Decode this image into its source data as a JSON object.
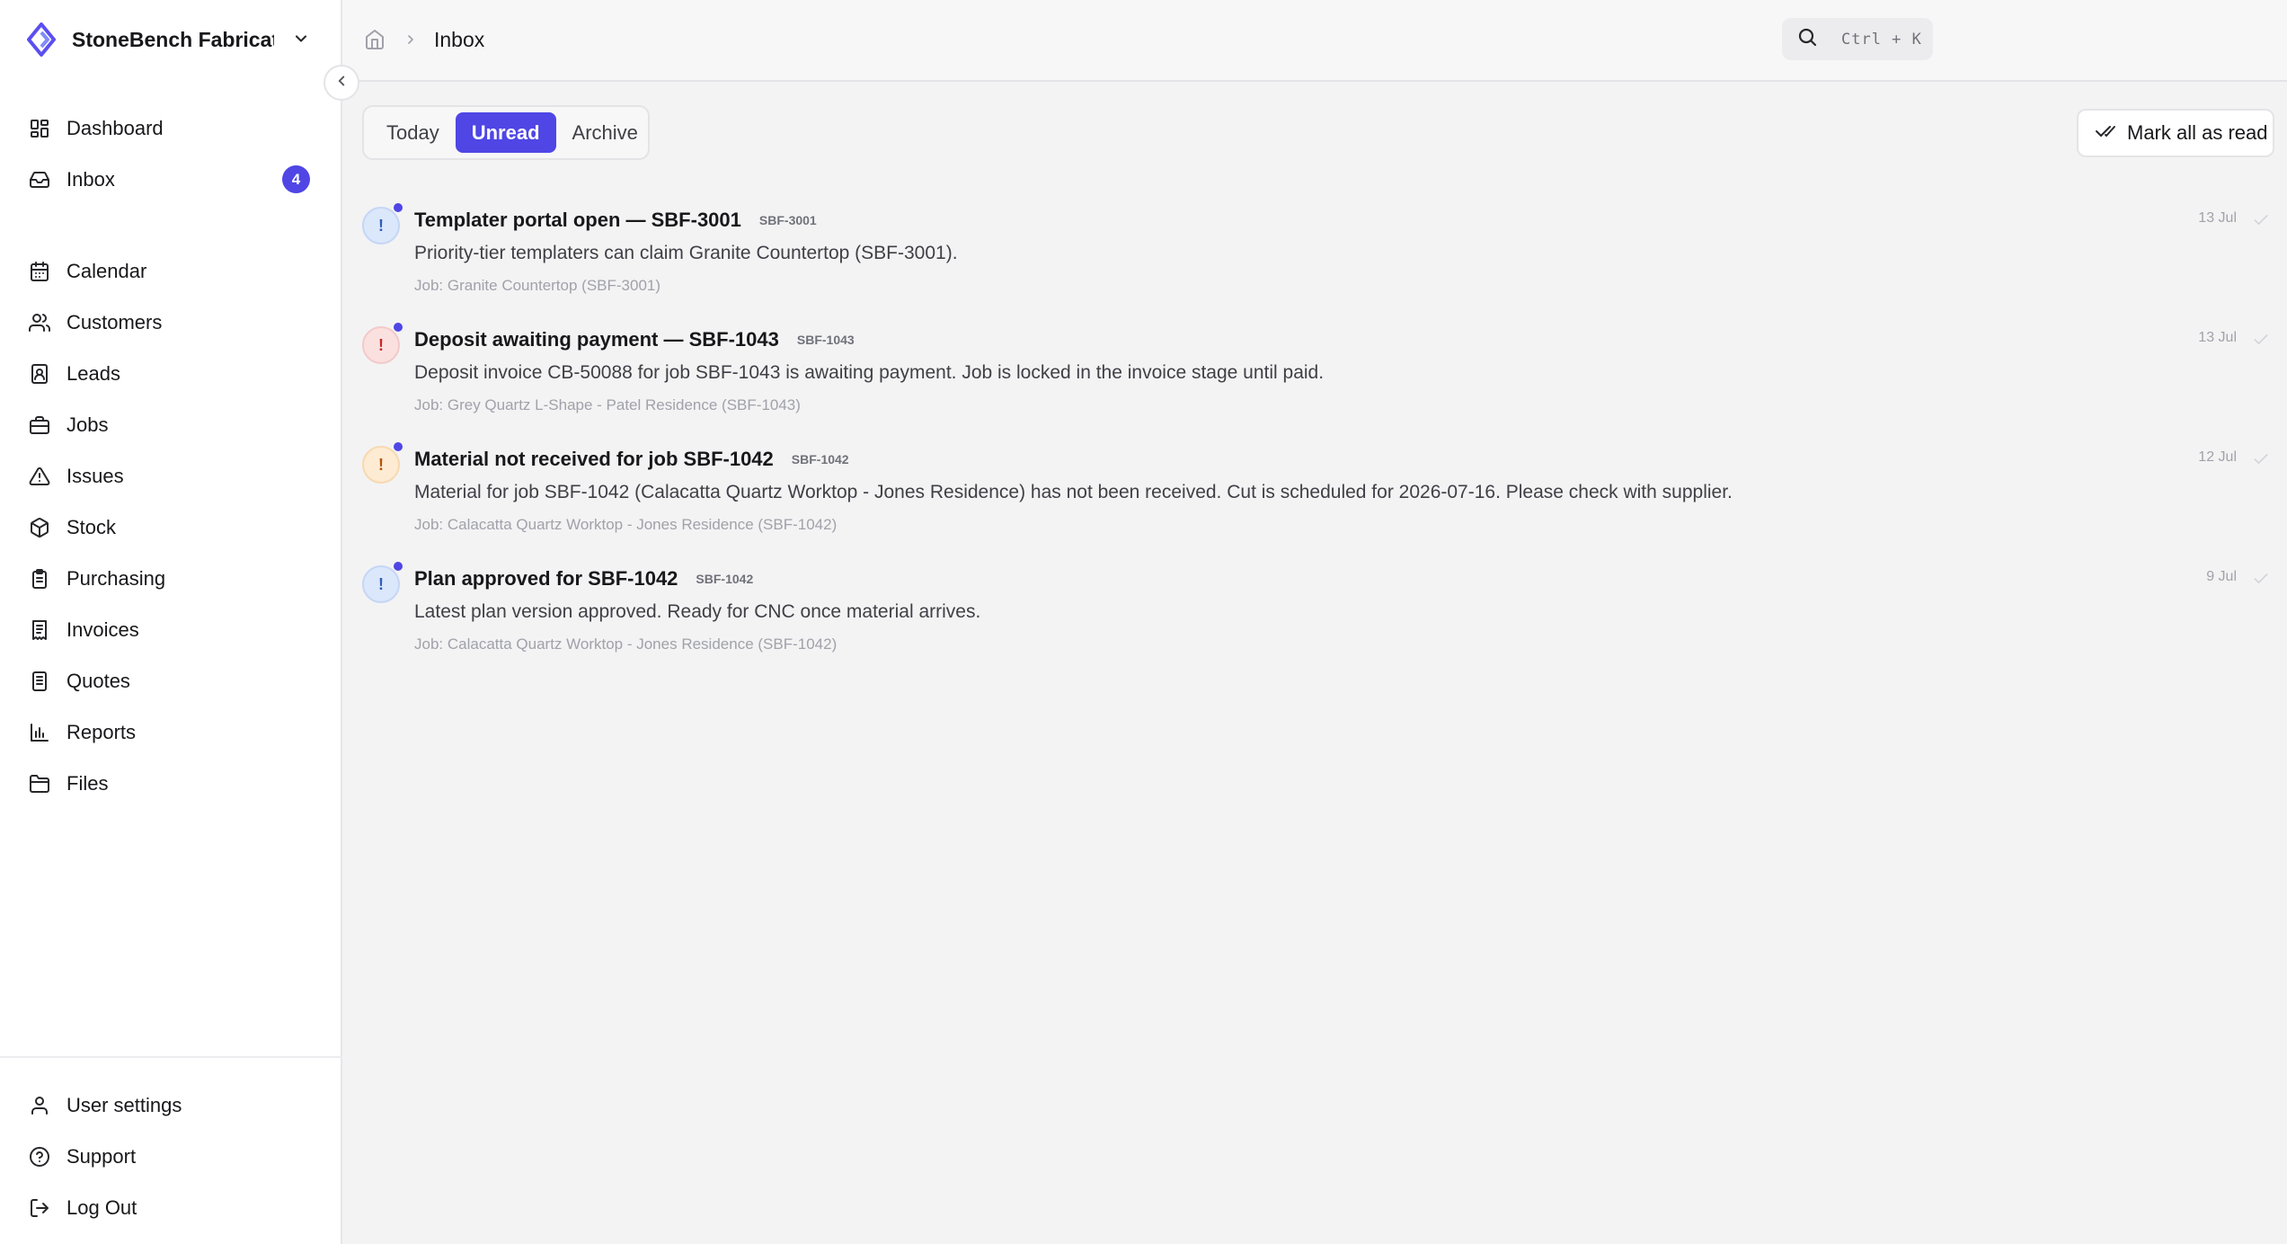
{
  "org": {
    "name": "StoneBench Fabricati..."
  },
  "sidebar": {
    "primary": [
      {
        "label": "Dashboard",
        "icon": "dashboard-icon"
      },
      {
        "label": "Inbox",
        "icon": "inbox-icon",
        "badge": "4"
      }
    ],
    "main": [
      {
        "label": "Calendar",
        "icon": "calendar-icon"
      },
      {
        "label": "Customers",
        "icon": "users-icon"
      },
      {
        "label": "Leads",
        "icon": "contact-icon"
      },
      {
        "label": "Jobs",
        "icon": "briefcase-icon"
      },
      {
        "label": "Issues",
        "icon": "warning-icon"
      },
      {
        "label": "Stock",
        "icon": "box-icon"
      },
      {
        "label": "Purchasing",
        "icon": "clipboard-icon"
      },
      {
        "label": "Invoices",
        "icon": "invoice-icon"
      },
      {
        "label": "Quotes",
        "icon": "quote-icon"
      },
      {
        "label": "Reports",
        "icon": "bar-chart-icon"
      },
      {
        "label": "Files",
        "icon": "folder-icon"
      }
    ],
    "footer": [
      {
        "label": "User settings",
        "icon": "user-icon"
      },
      {
        "label": "Support",
        "icon": "help-icon"
      },
      {
        "label": "Log Out",
        "icon": "logout-icon"
      }
    ]
  },
  "breadcrumb": {
    "current": "Inbox"
  },
  "search": {
    "shortcut": "Ctrl + K"
  },
  "tabs": [
    {
      "label": "Today",
      "active": false
    },
    {
      "label": "Unread",
      "active": true
    },
    {
      "label": "Archive",
      "active": false
    }
  ],
  "toolbar": {
    "mark_all_label": "Mark all as read"
  },
  "notifications": [
    {
      "title": "Templater portal open — SBF-3001",
      "ref": "SBF-3001",
      "body": "Priority-tier templaters can claim Granite Countertop (SBF-3001).",
      "job": "Job: Granite Countertop (SBF-3001)",
      "date": "13 Jul",
      "severity": "info",
      "unread": true
    },
    {
      "title": "Deposit awaiting payment — SBF-1043",
      "ref": "SBF-1043",
      "body": "Deposit invoice CB-50088 for job SBF-1043 is awaiting payment. Job is locked in the invoice stage until paid.",
      "job": "Job: Grey Quartz L-Shape - Patel Residence (SBF-1043)",
      "date": "13 Jul",
      "severity": "error",
      "unread": true
    },
    {
      "title": "Material not received for job SBF-1042",
      "ref": "SBF-1042",
      "body": "Material for job SBF-1042 (Calacatta Quartz Worktop - Jones Residence) has not been received. Cut is scheduled for 2026-07-16. Please check with supplier.",
      "job": "Job: Calacatta Quartz Worktop - Jones Residence (SBF-1042)",
      "date": "12 Jul",
      "severity": "warning",
      "unread": true
    },
    {
      "title": "Plan approved for SBF-1042",
      "ref": "SBF-1042",
      "body": "Latest plan version approved. Ready for CNC once material arrives.",
      "job": "Job: Calacatta Quartz Worktop - Jones Residence (SBF-1042)",
      "date": "9 Jul",
      "severity": "info",
      "unread": true
    }
  ],
  "colors": {
    "accent": "#4f46e5",
    "info": "#2f5fb8",
    "error": "#c62828",
    "warning": "#b45309"
  }
}
